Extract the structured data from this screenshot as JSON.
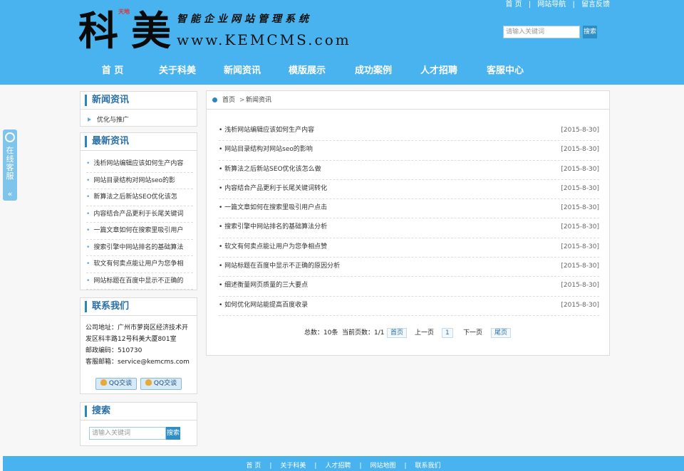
{
  "header": {
    "top_links": [
      "首 页",
      "网站导航",
      "留言反馈"
    ],
    "logo": {
      "char1": "科",
      "char2": "美",
      "badge": "天地",
      "tagline": "智能企业网站管理系统",
      "url": "www.KEMCMS.com"
    },
    "search": {
      "placeholder": "请输入关键词",
      "button": "搜索"
    },
    "nav": [
      "首 页",
      "关于科美",
      "新闻资讯",
      "模版展示",
      "成功案例",
      "人才招聘",
      "客服中心"
    ]
  },
  "float_service": {
    "label": "在线客服",
    "arrow": "«"
  },
  "sidebar": {
    "news_category": {
      "title": "新闻资讯",
      "items": [
        "优化与推广"
      ]
    },
    "latest": {
      "title": "最新资讯",
      "items": [
        "浅析网站编辑应该如何生产内容",
        "网站目录结构对网站seo的影",
        "新算法之后新站SEO优化该怎",
        "内容结合产品更利于长尾关键词",
        "一篇文章如何在搜索里吸引用户",
        "搜索引擎中网站排名的基础算法",
        "软文有何卖点能让用户为您争相",
        "网站标题在百度中显示不正确的"
      ]
    },
    "contact": {
      "title": "联系我们",
      "lines": [
        "公司地址：广州市萝岗区经济技术开",
        "发区科丰路12号科美大厦801室",
        "邮政编码：510730",
        "客服邮箱：service@kemcms.com"
      ],
      "qq_buttons": [
        "QQ交谈",
        "QQ交谈"
      ]
    },
    "search": {
      "title": "搜索",
      "placeholder": "请输入关键词",
      "button": "搜索"
    }
  },
  "main": {
    "breadcrumb": {
      "home": "首页",
      "separator": ">",
      "current": "新闻资讯"
    },
    "news": [
      {
        "title": "浅析网站编辑应该如何生产内容",
        "date": "[2015-8-30]"
      },
      {
        "title": "网站目录结构对网站seo的影响",
        "date": "[2015-8-30]"
      },
      {
        "title": "新算法之后新站SEO优化该怎么做",
        "date": "[2015-8-30]"
      },
      {
        "title": "内容结合产品更利于长尾关键词转化",
        "date": "[2015-8-30]"
      },
      {
        "title": "一篇文章如何在搜索里吸引用户点击",
        "date": "[2015-8-30]"
      },
      {
        "title": "搜索引擎中网站排名的基础算法分析",
        "date": "[2015-8-30]"
      },
      {
        "title": "软文有何卖点能让用户为您争相点赞",
        "date": "[2015-8-30]"
      },
      {
        "title": "网站标题在百度中显示不正确的原因分析",
        "date": "[2015-8-30]"
      },
      {
        "title": "细述衡量网页质量的三大要点",
        "date": "[2015-8-30]"
      },
      {
        "title": "如何优化网站能提高百度收录",
        "date": "[2015-8-30]"
      }
    ],
    "pager": {
      "total": "总数：10条",
      "current": "当前页数：1/1",
      "first": "首页",
      "prev": "上一页",
      "page": "1",
      "next": "下一页",
      "last": "尾页"
    }
  },
  "footer": {
    "links": [
      "首 页",
      "关于科美",
      "人才招聘",
      "网站地图",
      "联系我们"
    ],
    "separator": "|"
  },
  "colors": {
    "brand_blue": "#48b3ee",
    "title_blue": "#2a6fa5",
    "accent": "#2a86c2"
  }
}
